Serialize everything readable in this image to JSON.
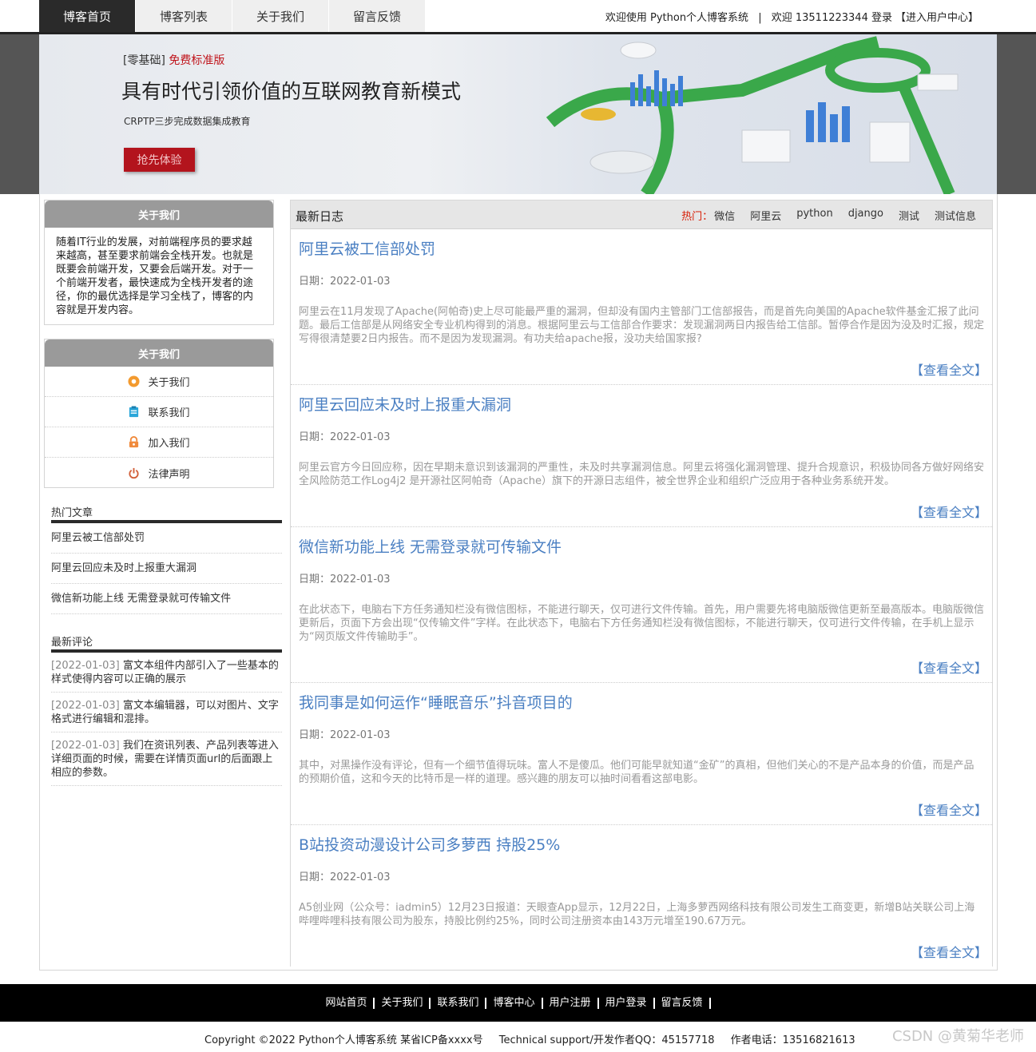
{
  "nav": {
    "tabs": [
      "博客首页",
      "博客列表",
      "关于我们",
      "留言反馈"
    ],
    "welcome": "欢迎使用 Python个人博客系统",
    "separator": "|",
    "user": "欢迎 13511223344 登录",
    "user_center": "【进入用户中心】"
  },
  "banner": {
    "sub_prefix": "[零基础]",
    "sub_red": "免费标准版",
    "headline": "具有时代引领价值的互联网教育新模式",
    "desc": "CRPTP三步完成数据集成教育",
    "cta": "抢先体验",
    "slides": 3,
    "active_slide": 1
  },
  "about_box": {
    "title": "关于我们",
    "text": "随着IT行业的发展，对前端程序员的要求越来越高，甚至要求前端会全栈开发。也就是既要会前端开发，又要会后端开发。对于一个前端开发者，最快速成为全栈开发者的途径，你的最优选择是学习全栈了，博客的内容就是开发内容。"
  },
  "links_box": {
    "title": "关于我们",
    "items": [
      {
        "label": "关于我们",
        "icon": "sun-icon",
        "color": "#f39a2e"
      },
      {
        "label": "联系我们",
        "icon": "clipboard-icon",
        "color": "#2aa6d9"
      },
      {
        "label": "加入我们",
        "icon": "lock-icon",
        "color": "#f08a3c"
      },
      {
        "label": "法律声明",
        "icon": "power-icon",
        "color": "#d2603a"
      }
    ]
  },
  "hot_articles": {
    "title": "热门文章",
    "items": [
      "阿里云被工信部处罚",
      "阿里云回应未及时上报重大漏洞",
      "微信新功能上线 无需登录就可传输文件"
    ]
  },
  "comments": {
    "title": "最新评论",
    "items": [
      {
        "date": "[2022-01-03]",
        "text": "富文本组件内部引入了一些基本的样式使得内容可以正确的展示"
      },
      {
        "date": "[2022-01-03]",
        "text": "富文本编辑器，可以对图片、文字格式进行编辑和混排。"
      },
      {
        "date": "[2022-01-03]",
        "text": "我们在资讯列表、产品列表等进入详细页面的时候，需要在详情页面url的后面跟上相应的参数。"
      }
    ]
  },
  "main": {
    "title": "最新日志",
    "hot_label": "热门：",
    "tags": [
      "微信",
      "阿里云",
      "python",
      "django",
      "测试",
      "测试信息"
    ],
    "more_label": "【查看全文】",
    "posts": [
      {
        "title": "阿里云被工信部处罚",
        "date": "日期：2022-01-03",
        "content": "阿里云在11月发现了Apache(阿帕奇)史上尽可能最严重的漏洞，但却没有国内主管部门工信部报告，而是首先向美国的Apache软件基金汇报了此问题。最后工信部是从网络安全专业机构得到的消息。根据阿里云与工信部合作要求：发现漏洞两日内报告给工信部。暂停合作是因为没及时汇报，规定写得很清楚要2日内报告。而不是因为发现漏洞。有功夫给apache报，没功夫给国家报?"
      },
      {
        "title": "阿里云回应未及时上报重大漏洞",
        "date": "日期：2022-01-03",
        "content": "阿里云官方今日回应称，因在早期未意识到该漏洞的严重性，未及时共享漏洞信息。阿里云将强化漏洞管理、提升合规意识，积极协同各方做好网络安全风险防范工作Log4j2 是开源社区阿帕奇（Apache）旗下的开源日志组件，被全世界企业和组织广泛应用于各种业务系统开发。"
      },
      {
        "title": "微信新功能上线 无需登录就可传输文件",
        "date": "日期：2022-01-03",
        "content": "在此状态下，电脑右下方任务通知栏没有微信图标，不能进行聊天，仅可进行文件传输。首先，用户需要先将电脑版微信更新至最高版本。电脑版微信更新后，页面下方会出现“仅传输文件”字样。在此状态下，电脑右下方任务通知栏没有微信图标，不能进行聊天，仅可进行文件传输，在手机上显示为“网页版文件传输助手”。"
      },
      {
        "title": "我同事是如何运作“睡眠音乐”抖音项目的",
        "date": "日期：2022-01-03",
        "content": "其中，对黑操作没有评论，但有一个细节值得玩味。富人不是傻瓜。他们可能早就知道“金矿”的真相，但他们关心的不是产品本身的价值，而是产品的预期价值，这和今天的比特币是一样的道理。感兴趣的朋友可以抽时间看看这部电影。"
      },
      {
        "title": "B站投资动漫设计公司多萝西 持股25%",
        "date": "日期：2022-01-03",
        "content": "A5创业网（公众号：iadmin5）12月23日报道：天眼查App显示，12月22日，上海多萝西网络科技有限公司发生工商变更，新增B站关联公司上海哔哩哔哩科技有限公司为股东，持股比例约25%，同时公司注册资本由143万元增至190.67万元。"
      }
    ]
  },
  "footer": {
    "links": [
      "网站首页",
      "关于我们",
      "联系我们",
      "博客中心",
      "用户注册",
      "用户登录",
      "留言反馈"
    ],
    "copyright": "Copyright ©2022 Python个人博客系统 某省ICP备xxxx号",
    "support": "Technical support/开发作者QQ：45157718",
    "phone": "作者电话：13516821613"
  },
  "watermark": "CSDN @黄菊华老师"
}
